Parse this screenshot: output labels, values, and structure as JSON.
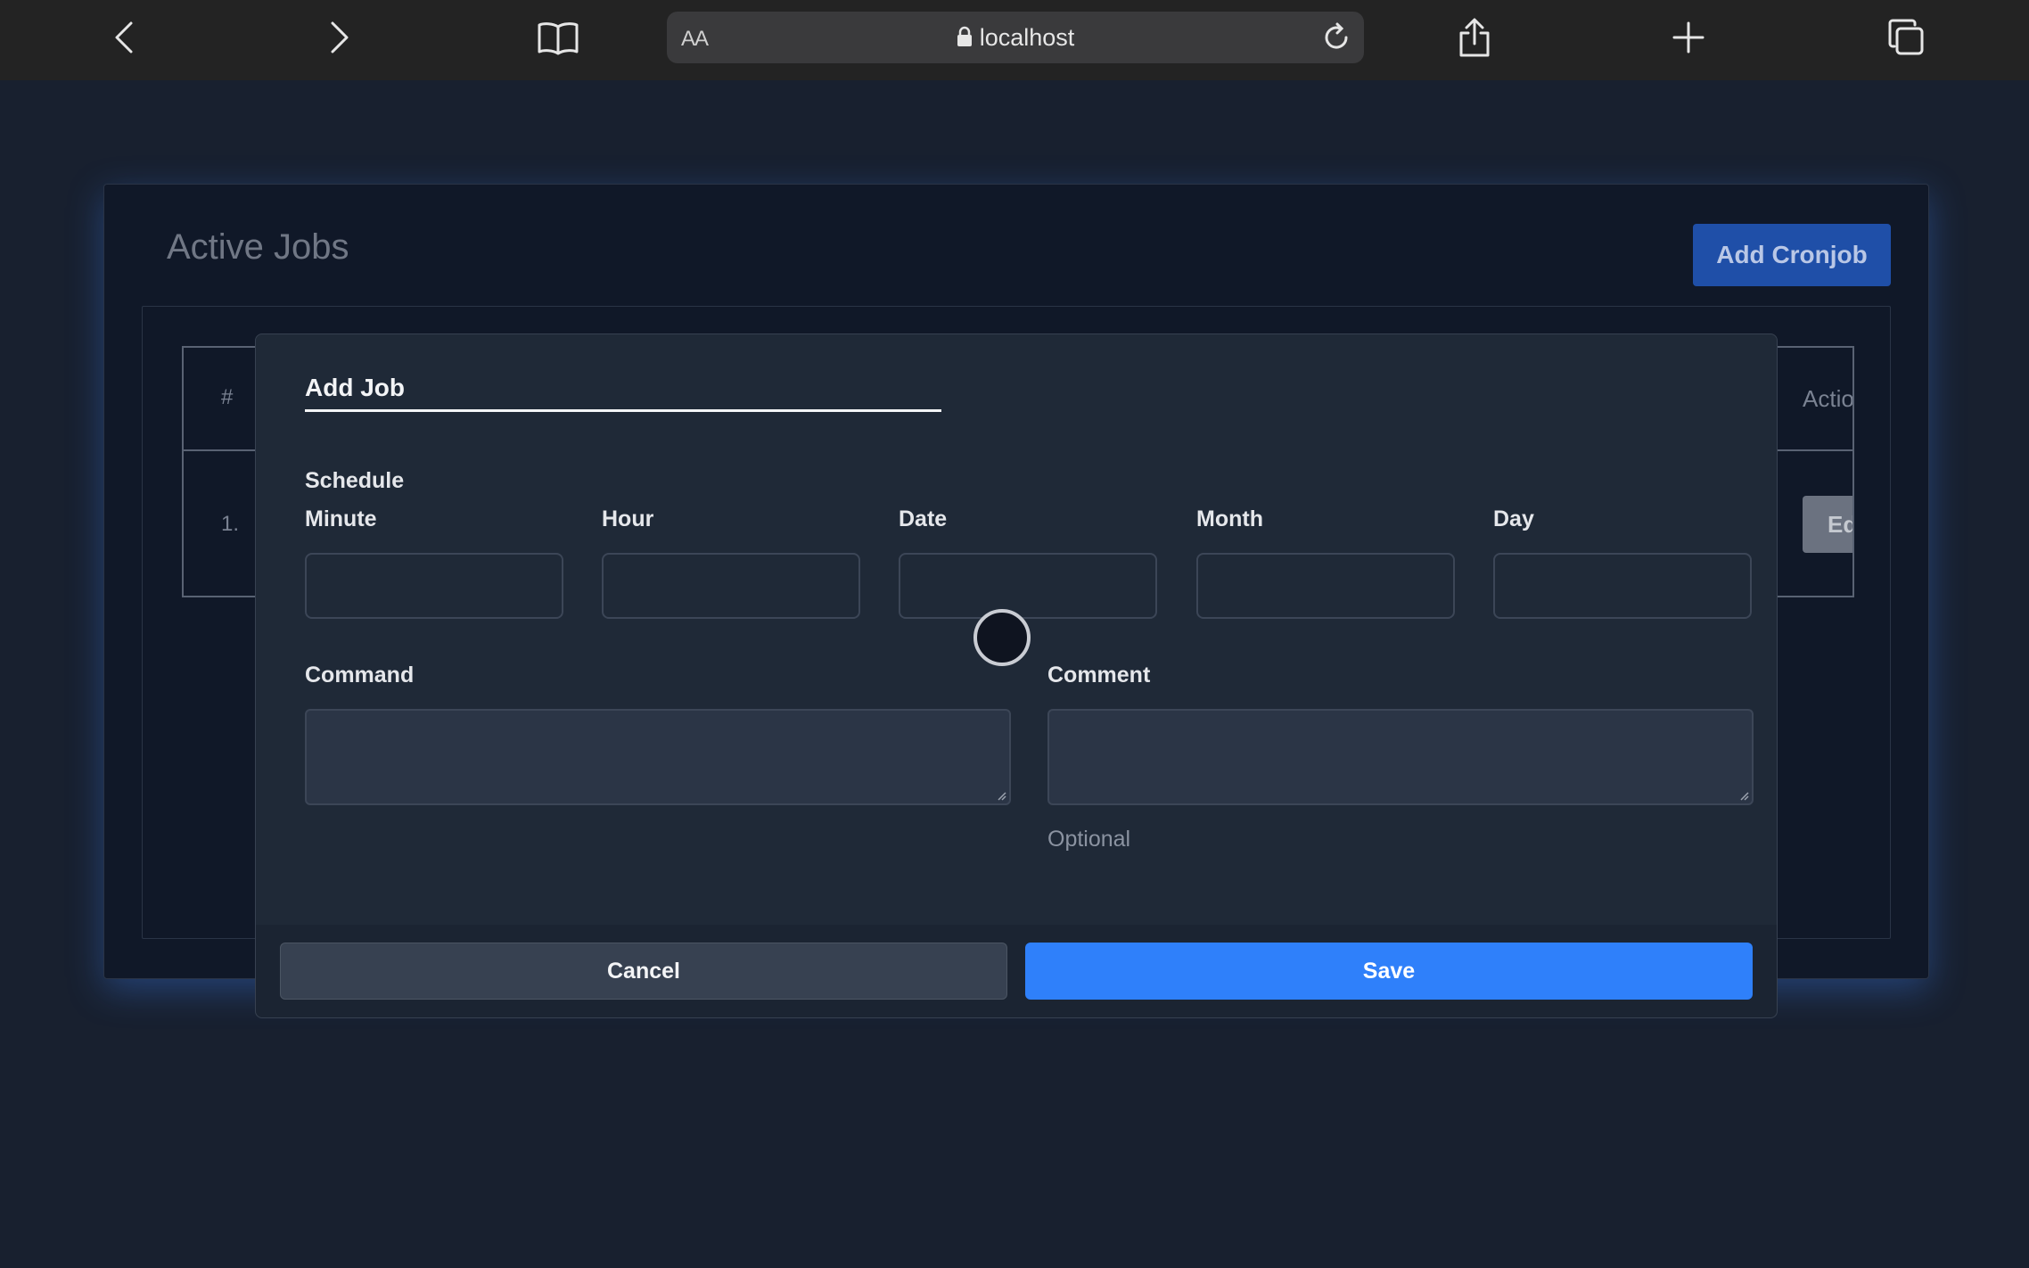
{
  "browser": {
    "reader_label": "AA",
    "url": "localhost"
  },
  "page": {
    "title": "Active Jobs",
    "add_button": "Add Cronjob",
    "table": {
      "hash_header": "#",
      "actions_header": "Actions",
      "rows": [
        {
          "num": "1.",
          "edit_label": "Edit"
        }
      ]
    }
  },
  "modal": {
    "title": "Add Job",
    "schedule_label": "Schedule",
    "fields": {
      "minute": "Minute",
      "hour": "Hour",
      "date": "Date",
      "month": "Month",
      "day": "Day"
    },
    "command_label": "Command",
    "comment_label": "Comment",
    "comment_hint": "Optional",
    "cancel": "Cancel",
    "save": "Save"
  }
}
